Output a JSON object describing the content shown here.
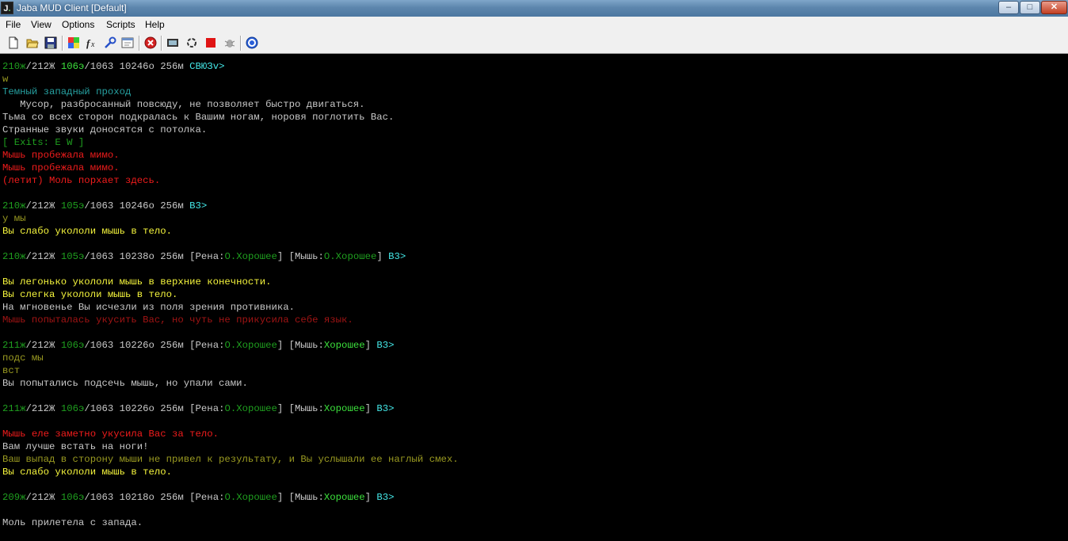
{
  "window": {
    "title": "Jaba MUD Client [Default]",
    "icon_letter": "J",
    "icon_suffix": ".",
    "controls": {
      "minimize": "–",
      "maximize": "□",
      "close": "✕"
    }
  },
  "menu": [
    "File",
    "View",
    "Options",
    "Scripts",
    "Help"
  ],
  "toolbar_icons": [
    "new-file-icon",
    "open-folder-icon",
    "save-icon",
    "color-palette-icon",
    "functions-icon",
    "settings-wrench-icon",
    "window-icon",
    "stop-icon",
    "record-icon",
    "cycle-icon",
    "red-square-icon",
    "bug-icon",
    "help-icon"
  ],
  "colors": {
    "hp": "#1f9f1f",
    "energy": "#3ce03c",
    "text": "#c8c8c8",
    "highlight": "#f5f53c",
    "command": "#9a9a21",
    "alert": "#f01c1c",
    "room_title": "#26a0a0",
    "exits": "#44e8e8"
  },
  "terminal": {
    "lines": [
      [
        [
          "dg",
          "210ж"
        ],
        [
          "w",
          "/212Ж "
        ],
        [
          "g",
          "106э"
        ],
        [
          "w",
          "/1063 10246о 256м "
        ],
        [
          "bc",
          "СВЮЗv>"
        ]
      ],
      [
        [
          "ol",
          "w"
        ]
      ],
      [
        [
          "c",
          "Темный западный проход"
        ]
      ],
      [
        [
          "w",
          "   Мусор, разбросанный повсюду, не позволяет быстро двигаться."
        ]
      ],
      [
        [
          "w",
          "Тьма со всех сторон подкралась к Вашим ногам, норовя поглотить Вас."
        ]
      ],
      [
        [
          "w",
          "Странные звуки доносятся с потолка."
        ]
      ],
      [
        [
          "dg",
          "[ Exits: E W ]"
        ]
      ],
      [
        [
          "r",
          "Мышь пробежала мимо."
        ]
      ],
      [
        [
          "r",
          "Мышь пробежала мимо."
        ]
      ],
      [
        [
          "r",
          "(летит) Моль порхает здесь."
        ]
      ],
      [],
      [
        [
          "dg",
          "210ж"
        ],
        [
          "w",
          "/212Ж "
        ],
        [
          "dg",
          "105э"
        ],
        [
          "w",
          "/1063 10246о 256м "
        ],
        [
          "bc",
          "В3>"
        ]
      ],
      [
        [
          "ol",
          "у мы"
        ]
      ],
      [
        [
          "y",
          "Вы слабо укололи мышь в тело."
        ]
      ],
      [],
      [
        [
          "dg",
          "210ж"
        ],
        [
          "w",
          "/212Ж "
        ],
        [
          "dg",
          "105э"
        ],
        [
          "w",
          "/1063 10238о 256м [Рена:"
        ],
        [
          "dg",
          "О.Хорошее"
        ],
        [
          "w",
          "] [Мышь:"
        ],
        [
          "dg",
          "О.Хорошее"
        ],
        [
          "w",
          "] "
        ],
        [
          "bc",
          "В3>"
        ]
      ],
      [],
      [
        [
          "y",
          "Вы легонько укололи мышь в верхние конечности."
        ]
      ],
      [
        [
          "y",
          "Вы слегка укололи мышь в тело."
        ]
      ],
      [
        [
          "w",
          "На мгновенье Вы исчезли из поля зрения противника."
        ]
      ],
      [
        [
          "dr",
          "Мышь попыталась укусить Вас, но чуть не прикусила себе язык."
        ]
      ],
      [],
      [
        [
          "dg",
          "211ж"
        ],
        [
          "w",
          "/212Ж "
        ],
        [
          "dg",
          "106э"
        ],
        [
          "w",
          "/1063 10226о 256м [Рена:"
        ],
        [
          "dg",
          "О.Хорошее"
        ],
        [
          "w",
          "] [Мышь:"
        ],
        [
          "g",
          "Хорошее"
        ],
        [
          "w",
          "] "
        ],
        [
          "bc",
          "В3>"
        ]
      ],
      [
        [
          "ol",
          "подс мы"
        ]
      ],
      [
        [
          "ol",
          "вст"
        ]
      ],
      [
        [
          "w",
          "Вы попытались подсечь мышь, но упали сами."
        ]
      ],
      [],
      [
        [
          "dg",
          "211ж"
        ],
        [
          "w",
          "/212Ж "
        ],
        [
          "dg",
          "106э"
        ],
        [
          "w",
          "/1063 10226о 256м [Рена:"
        ],
        [
          "dg",
          "О.Хорошее"
        ],
        [
          "w",
          "] [Мышь:"
        ],
        [
          "g",
          "Хорошее"
        ],
        [
          "w",
          "] "
        ],
        [
          "bc",
          "В3>"
        ]
      ],
      [],
      [
        [
          "r",
          "Мышь еле заметно укусила Вас за тело."
        ]
      ],
      [
        [
          "w",
          "Вам лучше встать на ноги!"
        ]
      ],
      [
        [
          "ol",
          "Ваш выпад в сторону мыши не привел к результату, и Вы услышали ее наглый смех."
        ]
      ],
      [
        [
          "y",
          "Вы слабо укололи мышь в тело."
        ]
      ],
      [],
      [
        [
          "dg",
          "209ж"
        ],
        [
          "w",
          "/212Ж "
        ],
        [
          "dg",
          "106э"
        ],
        [
          "w",
          "/1063 10218о 256м [Рена:"
        ],
        [
          "dg",
          "О.Хорошее"
        ],
        [
          "w",
          "] [Мышь:"
        ],
        [
          "g",
          "Хорошее"
        ],
        [
          "w",
          "] "
        ],
        [
          "bc",
          "В3>"
        ]
      ],
      [],
      [
        [
          "w",
          "Моль прилетела с запада."
        ]
      ]
    ]
  }
}
